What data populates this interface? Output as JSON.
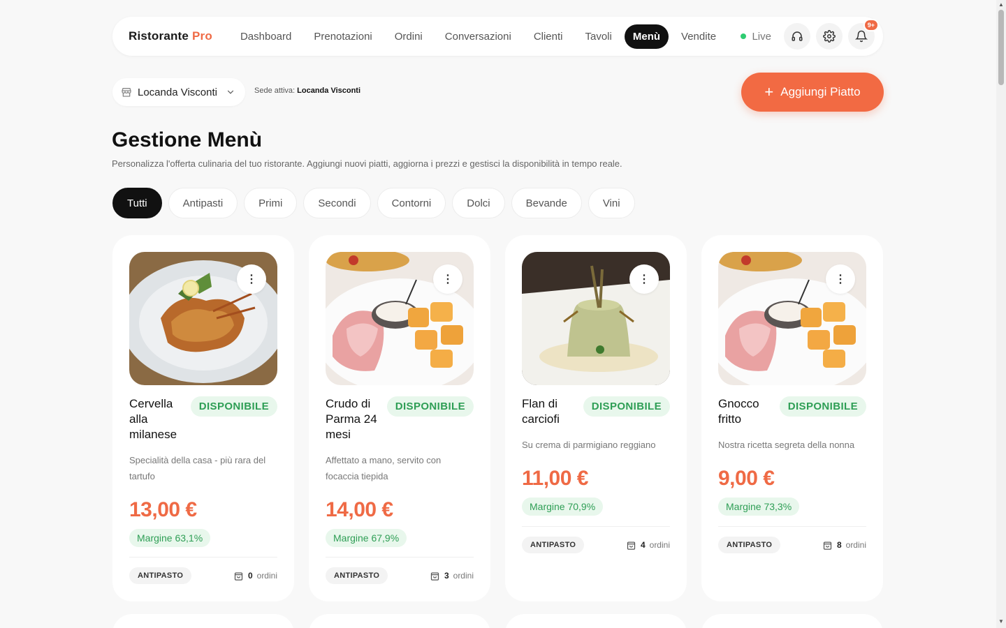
{
  "nav": {
    "logo_main": "Ristorante",
    "logo_accent": "Pro",
    "links": [
      "Dashboard",
      "Prenotazioni",
      "Ordini",
      "Conversazioni",
      "Clienti",
      "Tavoli",
      "Menù",
      "Vendite"
    ],
    "active_link": "Menù",
    "live_label": "Live",
    "notif_badge": "9+"
  },
  "location": {
    "selected": "Locanda Visconti",
    "active_prefix": "Sede attiva:",
    "active_name": "Locanda Visconti"
  },
  "add_button": "Aggiungi Piatto",
  "page": {
    "title": "Gestione Menù",
    "subtitle": "Personalizza l'offerta culinaria del tuo ristorante. Aggiungi nuovi piatti, aggiorna i prezzi e gestisci la disponibilità in tempo reale."
  },
  "categories": [
    "Tutti",
    "Antipasti",
    "Primi",
    "Secondi",
    "Contorni",
    "Dolci",
    "Bevande",
    "Vini"
  ],
  "active_category": "Tutti",
  "dishes": [
    {
      "name": "Cervella alla milanese",
      "status": "DISPONIBILE",
      "description": "Specialità della casa - più rara del tartufo",
      "price": "13,00 €",
      "margin": "Margine 63,1%",
      "category": "ANTIPASTO",
      "orders_count": "0",
      "orders_label": "ordini",
      "image": "fried-cutlet"
    },
    {
      "name": "Crudo di Parma 24 mesi",
      "status": "DISPONIBILE",
      "description": "Affettato a mano, servito con focaccia tiepida",
      "price": "14,00 €",
      "margin": "Margine 67,9%",
      "category": "ANTIPASTO",
      "orders_count": "3",
      "orders_label": "ordini",
      "image": "prosciutto-platter"
    },
    {
      "name": "Flan di carciofi",
      "status": "DISPONIBILE",
      "description": "Su crema di parmigiano reggiano",
      "price": "11,00 €",
      "margin": "Margine 70,9%",
      "category": "ANTIPASTO",
      "orders_count": "4",
      "orders_label": "ordini",
      "image": "artichoke-flan"
    },
    {
      "name": "Gnocco fritto",
      "status": "DISPONIBILE",
      "description": "Nostra ricetta segreta della nonna",
      "price": "9,00 €",
      "margin": "Margine 73,3%",
      "category": "ANTIPASTO",
      "orders_count": "8",
      "orders_label": "ordini",
      "image": "prosciutto-platter"
    }
  ],
  "colors": {
    "accent": "#ef6a45",
    "status_green": "#2e9e55",
    "status_bg": "#e8f7ec",
    "live": "#2ecc71"
  }
}
